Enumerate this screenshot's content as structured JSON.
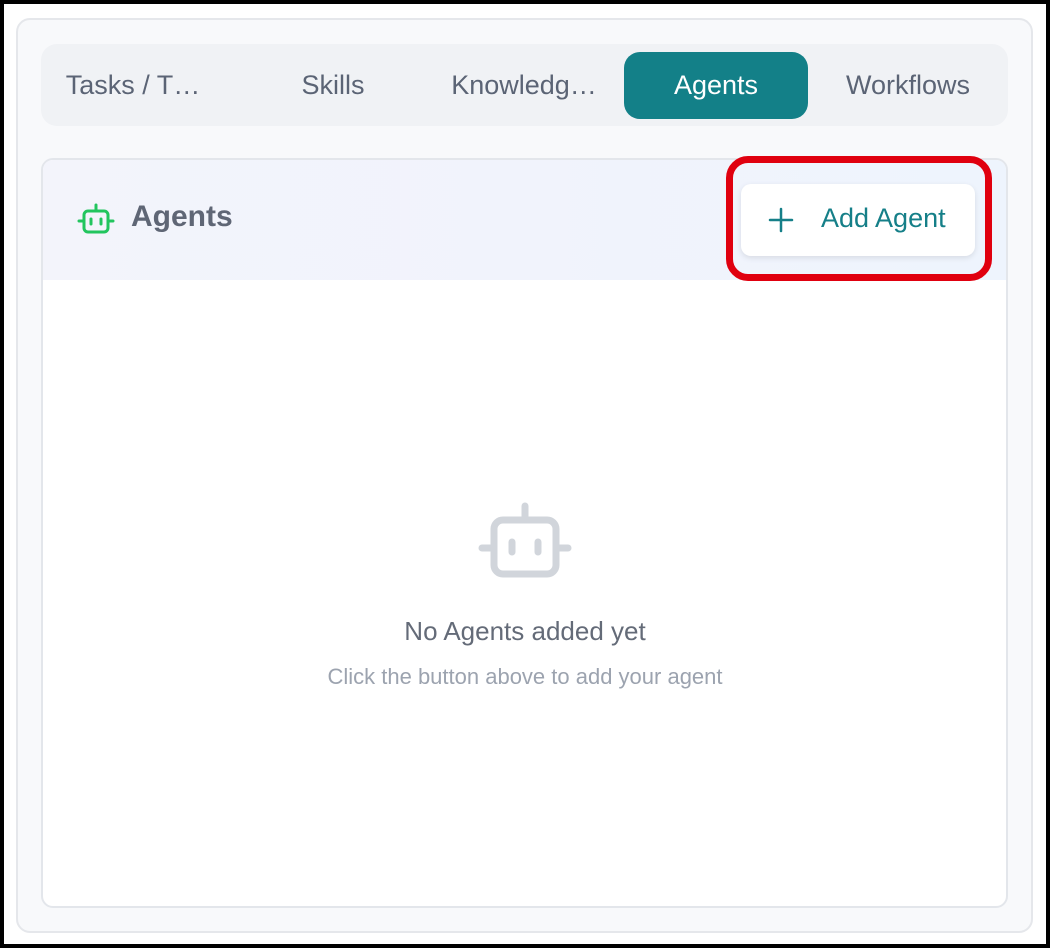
{
  "tabs": [
    {
      "label": "Tasks / T…",
      "active": false
    },
    {
      "label": "Skills",
      "active": false
    },
    {
      "label": "Knowledg…",
      "active": false
    },
    {
      "label": "Agents",
      "active": true
    },
    {
      "label": "Workflows",
      "active": false
    }
  ],
  "section": {
    "title": "Agents",
    "icon": "robot-icon",
    "add_button_label": "Add Agent",
    "add_button_icon": "plus-icon"
  },
  "empty_state": {
    "icon": "robot-icon",
    "title": "No Agents added yet",
    "subtitle": "Click the button above to add your agent"
  },
  "colors": {
    "accent": "#138088",
    "icon_green": "#22c55e",
    "highlight_red": "#e0000f"
  }
}
